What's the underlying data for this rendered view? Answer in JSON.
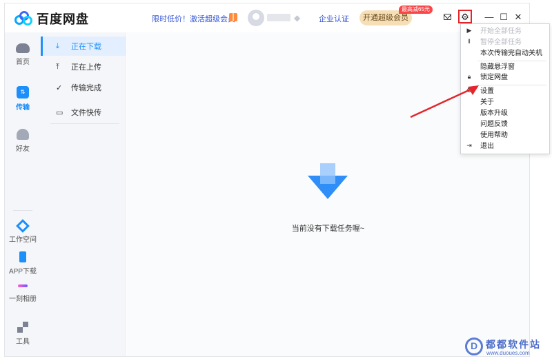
{
  "app": {
    "logo_text": "百度网盘",
    "promo_text": "限时低价！激活超级会员",
    "enterprise_link": "企业认证",
    "vip_button": "开通超级会员",
    "discount_badge": "最高减65元"
  },
  "window_controls": {
    "minimize": "—",
    "maximize": "☐",
    "close": "✕"
  },
  "rail": {
    "items": [
      {
        "label": "首页",
        "icon": "cloud-icon"
      },
      {
        "label": "传输",
        "icon": "transfer-icon",
        "active": true
      },
      {
        "label": "好友",
        "icon": "friends-icon"
      },
      {
        "label": "工作空间",
        "icon": "workspace-icon"
      },
      {
        "label": "APP下载",
        "icon": "phone-icon"
      },
      {
        "label": "一刻相册",
        "icon": "album-icon"
      },
      {
        "label": "工具",
        "icon": "tools-icon"
      }
    ]
  },
  "subnav": {
    "items": [
      {
        "label": "正在下载",
        "icon": "download-icon",
        "active": true
      },
      {
        "label": "正在上传",
        "icon": "upload-icon"
      },
      {
        "label": "传输完成",
        "icon": "check-circle-icon"
      },
      {
        "label": "文件快传",
        "icon": "monitor-icon"
      }
    ]
  },
  "main": {
    "empty_text": "当前没有下载任务喔~"
  },
  "menu": {
    "items": [
      {
        "label": "开始全部任务",
        "disabled": true
      },
      {
        "label": "暂停全部任务",
        "disabled": true
      },
      {
        "label": "本次传输完自动关机"
      },
      {
        "label": "隐藏悬浮窗"
      },
      {
        "label": "锁定网盘"
      },
      {
        "label": "设置"
      },
      {
        "label": "关于"
      },
      {
        "label": "版本升级"
      },
      {
        "label": "问题反馈"
      },
      {
        "label": "使用帮助"
      },
      {
        "label": "退出"
      }
    ]
  },
  "watermark": {
    "title": "都都软件站",
    "url": "www.duoues.com"
  },
  "colors": {
    "accent": "#1c8ffa",
    "highlight_red": "#e3262b",
    "vip_gold": "#f6dfb6"
  }
}
